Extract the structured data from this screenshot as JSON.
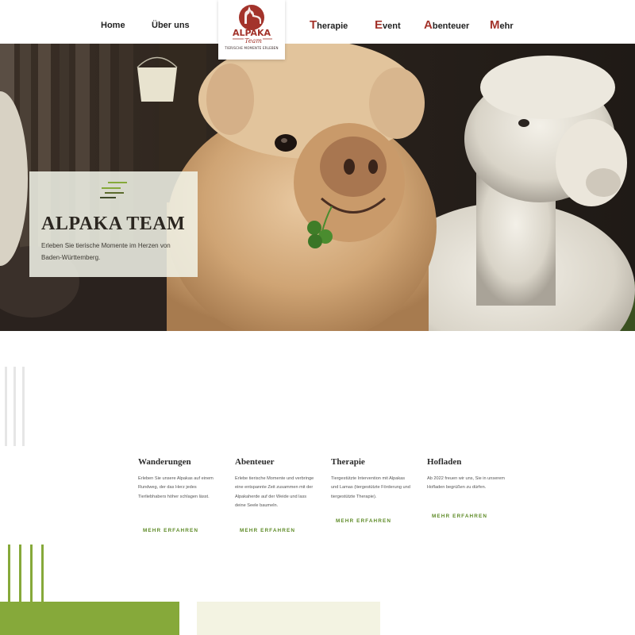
{
  "nav": {
    "home": "Home",
    "about": "Über uns",
    "therapie": {
      "initial": "T",
      "rest": "herapie"
    },
    "event": {
      "initial": "E",
      "rest": "vent"
    },
    "abenteuer": {
      "initial": "A",
      "rest": "benteuer"
    },
    "mehr": {
      "initial": "M",
      "rest": "ehr"
    }
  },
  "logo": {
    "text": "ALPAKA",
    "script": "Team",
    "tagline": "TIERISCHE MOMENTE ERLEBEN"
  },
  "hero": {
    "title": "ALPAKA TEAM",
    "text": "Erleben Sie tierische Momente im Herzen von Baden-Württemberg."
  },
  "services": [
    {
      "title": "Wanderungen",
      "text": "Erleben Sie unsere Alpakas auf einem Rundweg, der das Herz jedes Tierliebhabers höher schlagen lässt.",
      "link": "MEHR ERFAHREN"
    },
    {
      "title": "Abenteuer",
      "text": "Erlebe tierische Momente und verbringe eine entspannte Zeit zusammen mit der Alpakaherde auf der Weide und lass deine Seele baumeln.",
      "link": "MEHR ERFAHREN"
    },
    {
      "title": "Therapie",
      "text": "Tiergestützte Intervention mit Alpakas und Lamas (tiergestützte Förderung und tiergestützte Therapie).",
      "link": "MEHR ERFAHREN"
    },
    {
      "title": "Hofladen",
      "text": "Ab 2022 freuen wir uns, Sie in unserem Hofladen begrüßen zu dürfen.",
      "link": "MEHR ERFAHREN"
    }
  ],
  "colors": {
    "accent_red": "#a3332b",
    "accent_green": "#86a93a",
    "link_green": "#5e8b27",
    "cream": "#f3f3e2"
  }
}
